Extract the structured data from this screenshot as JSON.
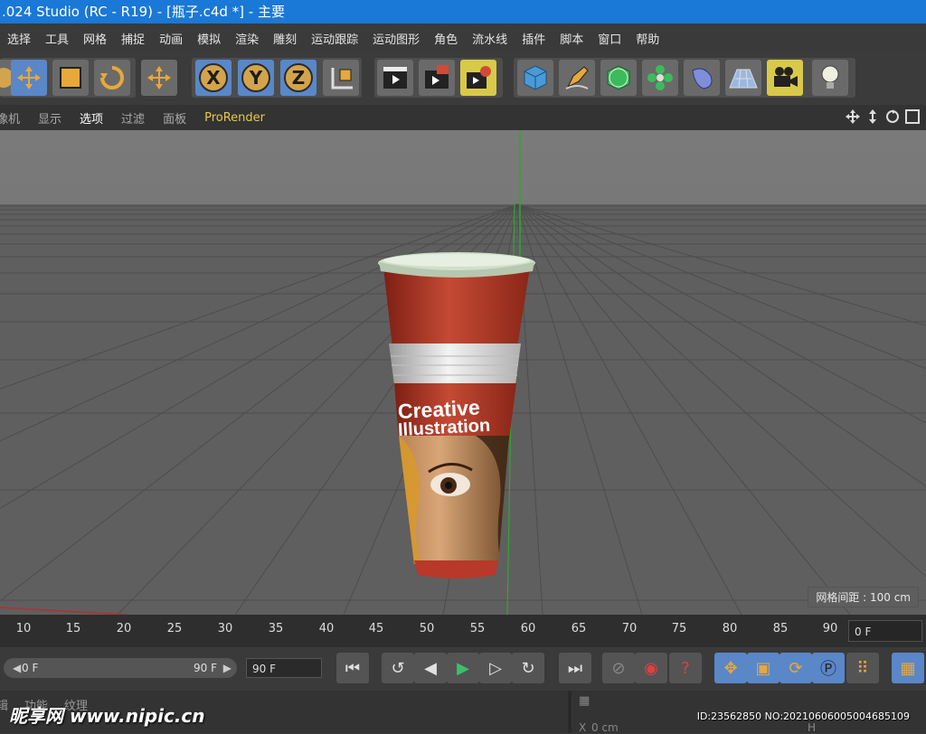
{
  "window": {
    "title": ".024 Studio (RC - R19) - [瓶子.c4d *] - 主要"
  },
  "menu": [
    "选择",
    "工具",
    "网格",
    "捕捉",
    "动画",
    "模拟",
    "渲染",
    "雕刻",
    "运动跟踪",
    "运动图形",
    "角色",
    "流水线",
    "插件",
    "脚本",
    "窗口",
    "帮助"
  ],
  "toolbar": {
    "axes": [
      "X",
      "Y",
      "Z"
    ],
    "icons": [
      "live-select-icon",
      "move-icon",
      "scale-icon",
      "rotate-icon",
      "transform-icon",
      "x-axis-icon",
      "y-axis-icon",
      "z-axis-icon",
      "coordinate-system-icon",
      "render-view-icon",
      "render-picture-viewer-icon",
      "render-settings-icon",
      "cube-icon",
      "pen-icon",
      "subdivision-icon",
      "cloner-icon",
      "deformer-icon",
      "floor-icon",
      "camera-icon",
      "light-icon"
    ]
  },
  "viewport_menu": {
    "items": [
      "像机",
      "显示",
      "选项",
      "过滤",
      "面板"
    ],
    "prorender": "ProRender"
  },
  "viewport": {
    "grid_spacing": "网格间距 : 100 cm",
    "cup_text_1": "Creative",
    "cup_text_2": "Illustration"
  },
  "timeline": {
    "ticks": [
      "10",
      "15",
      "20",
      "25",
      "30",
      "35",
      "40",
      "45",
      "50",
      "55",
      "60",
      "65",
      "70",
      "75",
      "80",
      "85",
      "90"
    ],
    "current_frame": "0 F",
    "range_start": "0 F",
    "range_end": "90 F",
    "max_frame": "90 F"
  },
  "bottom_panel": {
    "tabs": [
      "辑",
      "功能",
      "纹理"
    ],
    "coord_x": "0 cm",
    "coord_h": "H"
  },
  "watermark": {
    "site": "昵享网 www.nipic.cn",
    "id": "ID:23562850 NO:20210606005004685109"
  },
  "colors": {
    "title_bar": "#1a78d6",
    "accent_yellow": "#e6c84a",
    "cup_red": "#b83a2a",
    "cup_lid": "#d7e4d0"
  }
}
